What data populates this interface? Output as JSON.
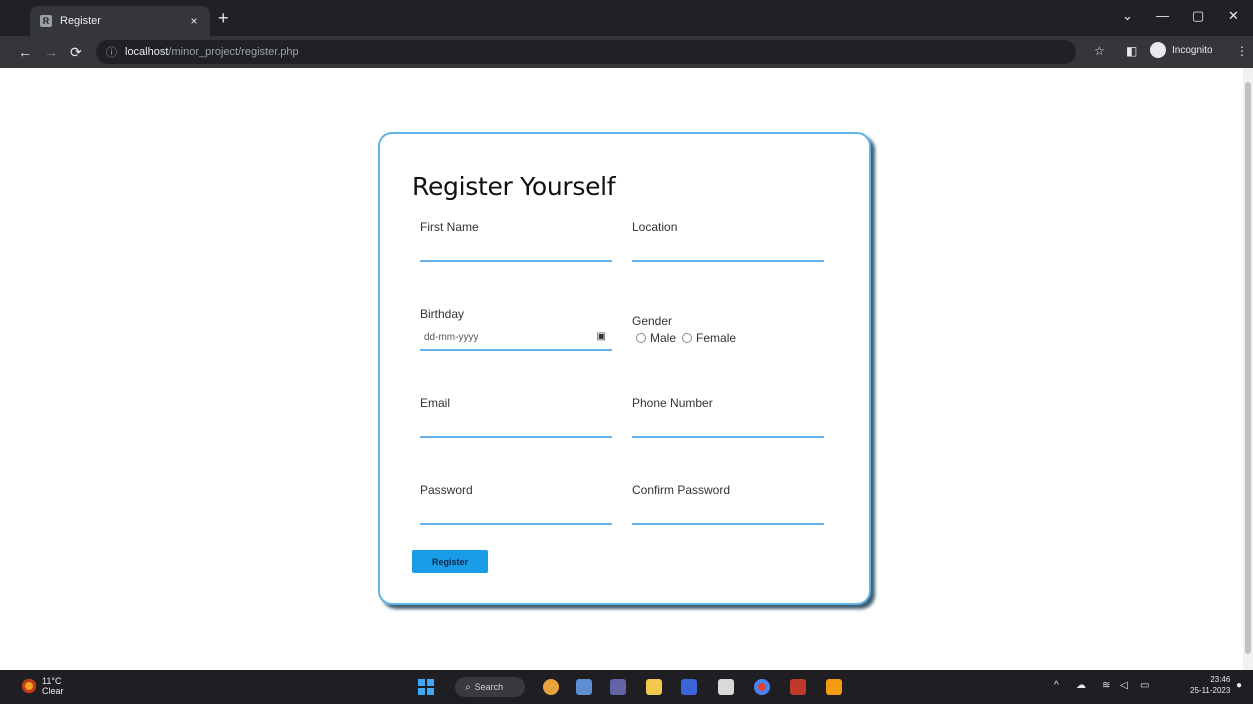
{
  "browser": {
    "tab_title": "Register",
    "tab_close": "×",
    "new_tab": "+",
    "url_host": "localhost",
    "url_path": "/minor_project/register.php",
    "profile_label": "Incognito",
    "window_minimize": "—",
    "window_restore": "▢",
    "window_close": "✕"
  },
  "form": {
    "title": "Register Yourself",
    "first_name_label": "First Name",
    "location_label": "Location",
    "birthday_label": "Birthday",
    "birthday_placeholder": "dd-mm-yyyy",
    "gender_label": "Gender",
    "gender_male": "Male",
    "gender_female": "Female",
    "email_label": "Email",
    "phone_label": "Phone Number",
    "password_label": "Password",
    "confirm_password_label": "Confirm Password",
    "register_button": "Register"
  },
  "taskbar": {
    "weather_temp": "11°C",
    "weather_desc": "Clear",
    "search_label": "Search",
    "time": "23:46",
    "date": "25-11-2023"
  },
  "colors": {
    "accent": "#62b3e8",
    "button": "#1a9de9"
  }
}
